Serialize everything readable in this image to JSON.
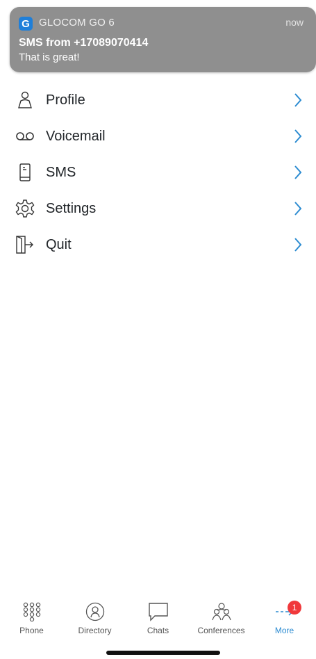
{
  "notification": {
    "app_icon_letter": "G",
    "app_name": "GLOCOM GO 6",
    "time": "now",
    "title": "SMS from +17089070414",
    "body": "That is great!"
  },
  "menu": {
    "items": [
      {
        "label": "Profile",
        "icon": "person-icon"
      },
      {
        "label": "Voicemail",
        "icon": "voicemail-icon"
      },
      {
        "label": "SMS",
        "icon": "phone-sms-icon"
      },
      {
        "label": "Settings",
        "icon": "gear-icon"
      },
      {
        "label": "Quit",
        "icon": "exit-door-icon"
      }
    ]
  },
  "tabbar": {
    "tabs": [
      {
        "label": "Phone",
        "icon": "keypad-icon"
      },
      {
        "label": "Directory",
        "icon": "directory-icon"
      },
      {
        "label": "Chats",
        "icon": "chat-bubble-icon"
      },
      {
        "label": "Conferences",
        "icon": "conferences-icon"
      },
      {
        "label": "More",
        "icon": "more-arrow-icon",
        "badge": "1",
        "active": true
      }
    ]
  },
  "colors": {
    "accent": "#2b8bd1",
    "badge": "#f0383b",
    "banner": "#8f8f8f"
  }
}
